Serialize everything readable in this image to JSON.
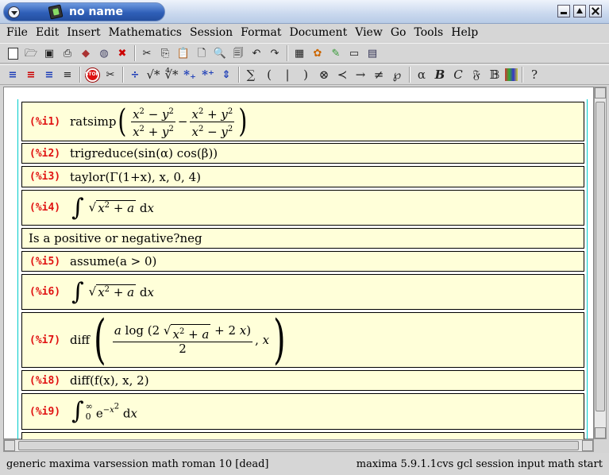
{
  "window": {
    "title": "no name"
  },
  "menubar": [
    "File",
    "Edit",
    "Insert",
    "Mathematics",
    "Session",
    "Format",
    "Document",
    "View",
    "Go",
    "Tools",
    "Help"
  ],
  "toolbar1": [
    "new-document-icon",
    "open-icon",
    "save-icon",
    "print-icon",
    "book-icon",
    "globe-icon",
    "cancel-x-icon",
    "cut-icon",
    "copy-icon",
    "paste-icon",
    "print-preview-icon",
    "search-icon",
    "find-replace-icon",
    "undo-icon",
    "redo-icon",
    "table-icon",
    "palette-icon",
    "pencil-icon",
    "window-icon",
    "terminal-icon"
  ],
  "toolbar2": {
    "sqrt1": "√*",
    "sqrt2": "∜*",
    "sub": "*₊",
    "sup": "*⁺",
    "sum": "∑",
    "lparen": "(",
    "bar": "|",
    "rparen": ")",
    "otimes": "⊗",
    "prec": "≺",
    "arrow": "→",
    "neq": "≠",
    "weier": "℘",
    "alpha": "α",
    "bold": "B",
    "cal": "C",
    "frak": "𝔉",
    "bb": "𝔹",
    "help": "?"
  },
  "session": {
    "cells": [
      {
        "prompt": "(%i1)",
        "fn": "ratsimp"
      },
      {
        "prompt": "(%i2)",
        "text": "trigreduce(sin(α) cos(β))"
      },
      {
        "prompt": "(%i3)",
        "text": "taylor(Γ(1+x), x, 0, 4)"
      },
      {
        "prompt": "(%i4)"
      },
      {
        "prompt": "(%i5)",
        "text": "assume(a > 0)"
      },
      {
        "prompt": "(%i6)"
      },
      {
        "prompt": "(%i7)",
        "fn": "diff"
      },
      {
        "prompt": "(%i8)",
        "text": "diff(f(x), x, 2)"
      },
      {
        "prompt": "(%i9)"
      }
    ],
    "question": "Is a positive or negative?neg"
  },
  "statusbar": {
    "left": "generic maxima varsession math roman 10 [dead]",
    "right": "maxima 5.9.1.1cvs gcl session input math start"
  },
  "colors": {
    "prompt": "#e01010",
    "cell_bg": "#ffffd9",
    "title_blue": "#2f5fb8",
    "frame_cyan": "#00cccc"
  }
}
